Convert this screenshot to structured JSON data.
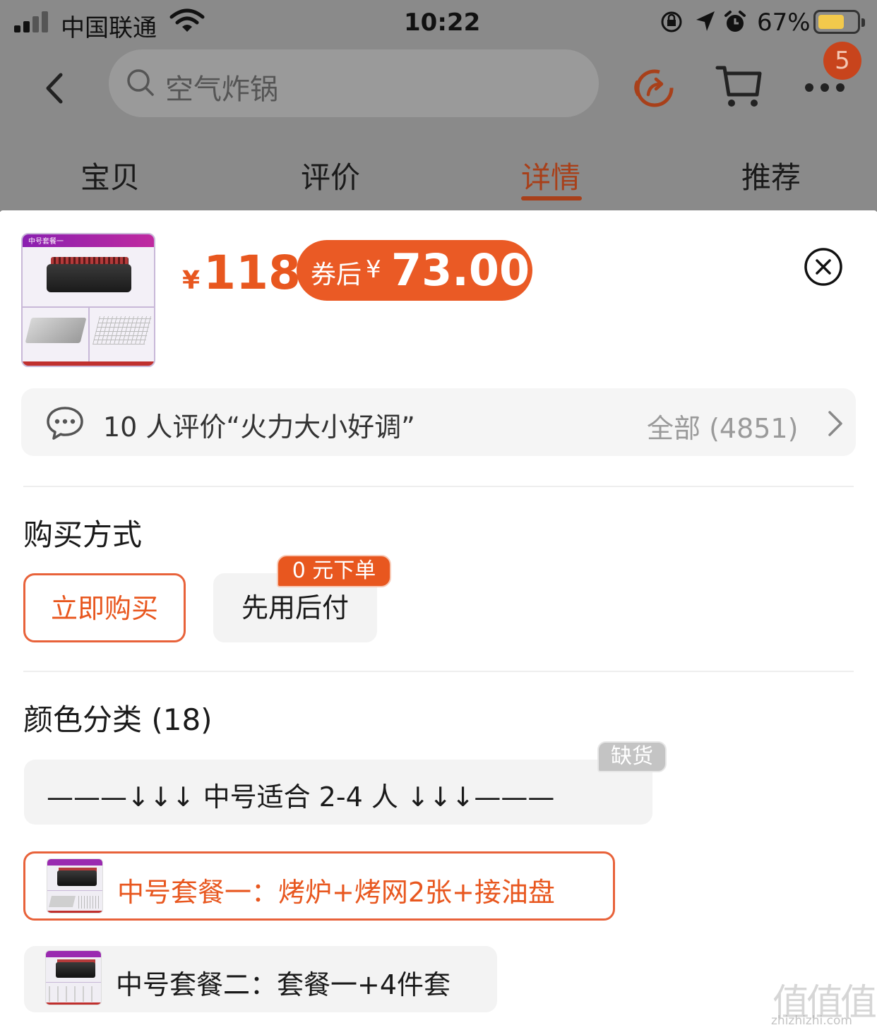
{
  "status_bar": {
    "carrier": "中国联通",
    "time": "10:22",
    "battery_pct": "67%",
    "battery_level": 0.67,
    "icons": [
      "signal-icon",
      "wifi-icon",
      "rotation-lock-icon",
      "location-icon",
      "alarm-icon",
      "battery-icon"
    ]
  },
  "nav": {
    "search_placeholder": "空气炸锅",
    "cart_badge": "5",
    "icons": [
      "back-icon",
      "search-icon",
      "share-icon",
      "cart-icon",
      "more-icon"
    ]
  },
  "tabs": [
    {
      "label": "宝贝",
      "active": false
    },
    {
      "label": "评价",
      "active": false
    },
    {
      "label": "详情",
      "active": true
    },
    {
      "label": "推荐",
      "active": false
    }
  ],
  "product": {
    "thumb_label": "中号套餐一",
    "currency": "¥",
    "price": "118",
    "coupon_label": "券后",
    "coupon_currency": "¥",
    "coupon_price": "73.00"
  },
  "review": {
    "text": "10 人评价“火力大小好调”",
    "all_label": "全部 (4851)"
  },
  "purchase": {
    "title": "购买方式",
    "options": [
      {
        "label": "立即购买",
        "selected": true
      },
      {
        "label": "先用后付",
        "selected": false,
        "badge": "0 元下单"
      }
    ]
  },
  "color": {
    "title": "颜色分类 (18)",
    "items": [
      {
        "label": "———↓↓↓ 中号适合 2-4 人 ↓↓↓———",
        "badge": "缺货",
        "selected": false
      },
      {
        "label": "中号套餐一：烤炉+烤网2张+接油盘",
        "selected": true
      },
      {
        "label": "中号套餐二：套餐一+4件套",
        "selected": false
      }
    ]
  },
  "watermark": {
    "glyphs": "值值值",
    "url": "zhizhizhi.com"
  },
  "colors": {
    "accent": "#e8571f",
    "coupon_bg": "#ea5a25",
    "overlay": "#8a8a8a",
    "tab_active_dim": "#a8401a"
  }
}
